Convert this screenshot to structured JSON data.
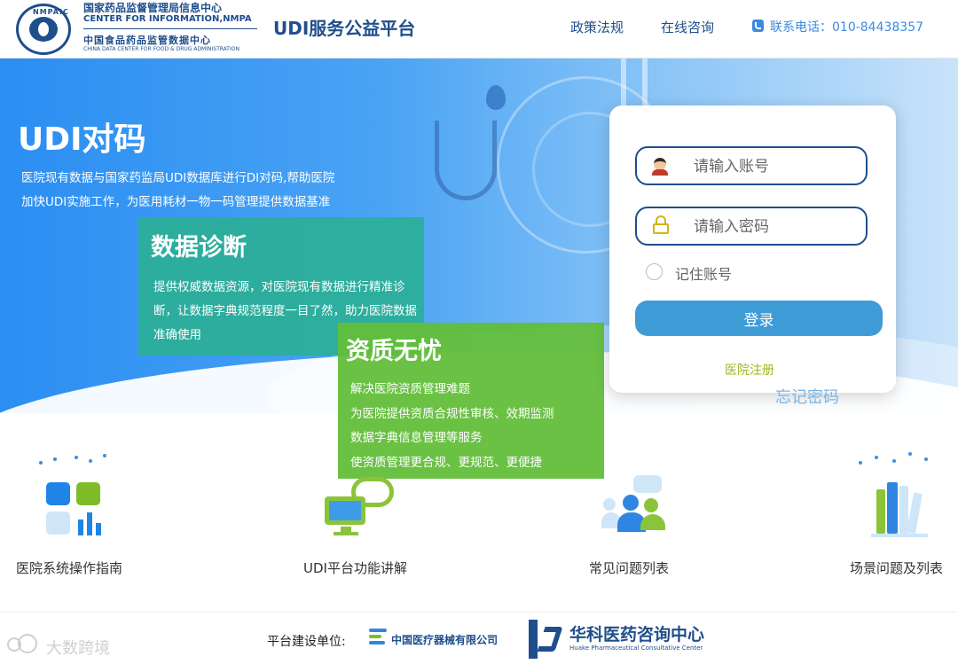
{
  "header": {
    "seal_text": "NMPAIC",
    "org_name_cn": "国家药品监督管理局信息中心",
    "org_name_en": "CENTER FOR INFORMATION,NMPA",
    "org_sub_cn": "中国食品药品监管数据中心",
    "org_sub_en": "CHINA DATA CENTER FOR FOOD & DRUG ADMINISTRATION",
    "platform_title": "UDI服务公益平台",
    "nav": {
      "policy": "政策法规",
      "consult": "在线咨询"
    },
    "phone_label": "联系电话：010-84438357"
  },
  "hero": {
    "title": "UDI对码",
    "description": "医院现有数据与国家药监局UDI数据库进行DI对码,帮助医院加快UDI实施工作，为医用耗材一物一码管理提供数据基准"
  },
  "cards": {
    "diagnosis": {
      "title": "数据诊断",
      "text": "提供权威数据资源，对医院现有数据进行精准诊断，让数据字典规范程度一目了然，助力医院数据准确使用"
    },
    "qualification": {
      "title": "资质无忧",
      "lines": [
        "解决医院资质管理难题",
        "为医院提供资质合规性审核、效期监测",
        "数据字典信息管理等服务",
        "使资质管理更合规、更规范、更便捷"
      ]
    }
  },
  "login": {
    "username_placeholder": "请输入账号",
    "password_placeholder": "请输入密码",
    "remember_label": "记住账号",
    "submit_label": "登录",
    "register_label": "医院注册",
    "forgot_label": "忘记密码"
  },
  "entries": [
    {
      "label": "医院系统操作指南",
      "icon": "dashboard-grid-icon"
    },
    {
      "label": "UDI平台功能讲解",
      "icon": "cloud-monitor-icon"
    },
    {
      "label": "常见问题列表",
      "icon": "people-chat-icon"
    },
    {
      "label": "场景问题及列表",
      "icon": "books-icon"
    }
  ],
  "footer": {
    "builder_label": "平台建设单位:",
    "company1": "中国医疗器械有限公司",
    "company2": "华科医药咨询中心",
    "company2_en": "Huake Pharmaceutical Consultative Center",
    "watermark": "大数跨境"
  },
  "colors": {
    "brand_navy": "#1f4e8c",
    "hero_blue": "#2b8ef2",
    "teal_card": "#2baf96",
    "green_card": "#62be3a",
    "login_button": "#3f9bd6",
    "register_link": "#9aba22"
  }
}
